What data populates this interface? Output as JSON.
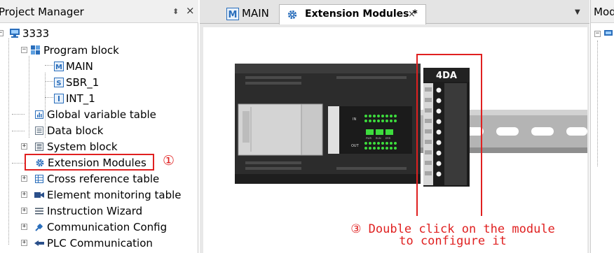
{
  "project_manager": {
    "title": "Project Manager",
    "pin_icon": "pin-icon",
    "close_icon": "close-icon",
    "tree": {
      "root": "3333",
      "program_block": "Program block",
      "program_items": [
        "MAIN",
        "SBR_1",
        "INT_1"
      ],
      "global_variable_table": "Global variable table",
      "data_block": "Data block",
      "system_block": "System block",
      "extension_modules": "Extension Modules",
      "cross_reference_table": "Cross reference table",
      "element_monitoring_table": "Element monitoring table",
      "instruction_wizard": "Instruction Wizard",
      "communication_config": "Communication Config",
      "plc_communication": "PLC Communication"
    },
    "annotation_marker": "①"
  },
  "editor": {
    "tabs": [
      {
        "label": "MAIN",
        "active": false
      },
      {
        "label": "Extension Modules *",
        "active": true,
        "close": "×"
      }
    ],
    "module_label": "4DA",
    "plc_labels": {
      "in": "IN",
      "out": "OUT",
      "status": [
        "PWR",
        "RUN",
        "ERR"
      ]
    },
    "annotation_line1": "③ Double click on the module",
    "annotation_line2": "to configure it"
  },
  "right_panel": {
    "title": "Mod"
  },
  "colors": {
    "accent_red": "#e02020",
    "icon_blue": "#2a6ebb",
    "led_green": "#3ddc3d"
  }
}
